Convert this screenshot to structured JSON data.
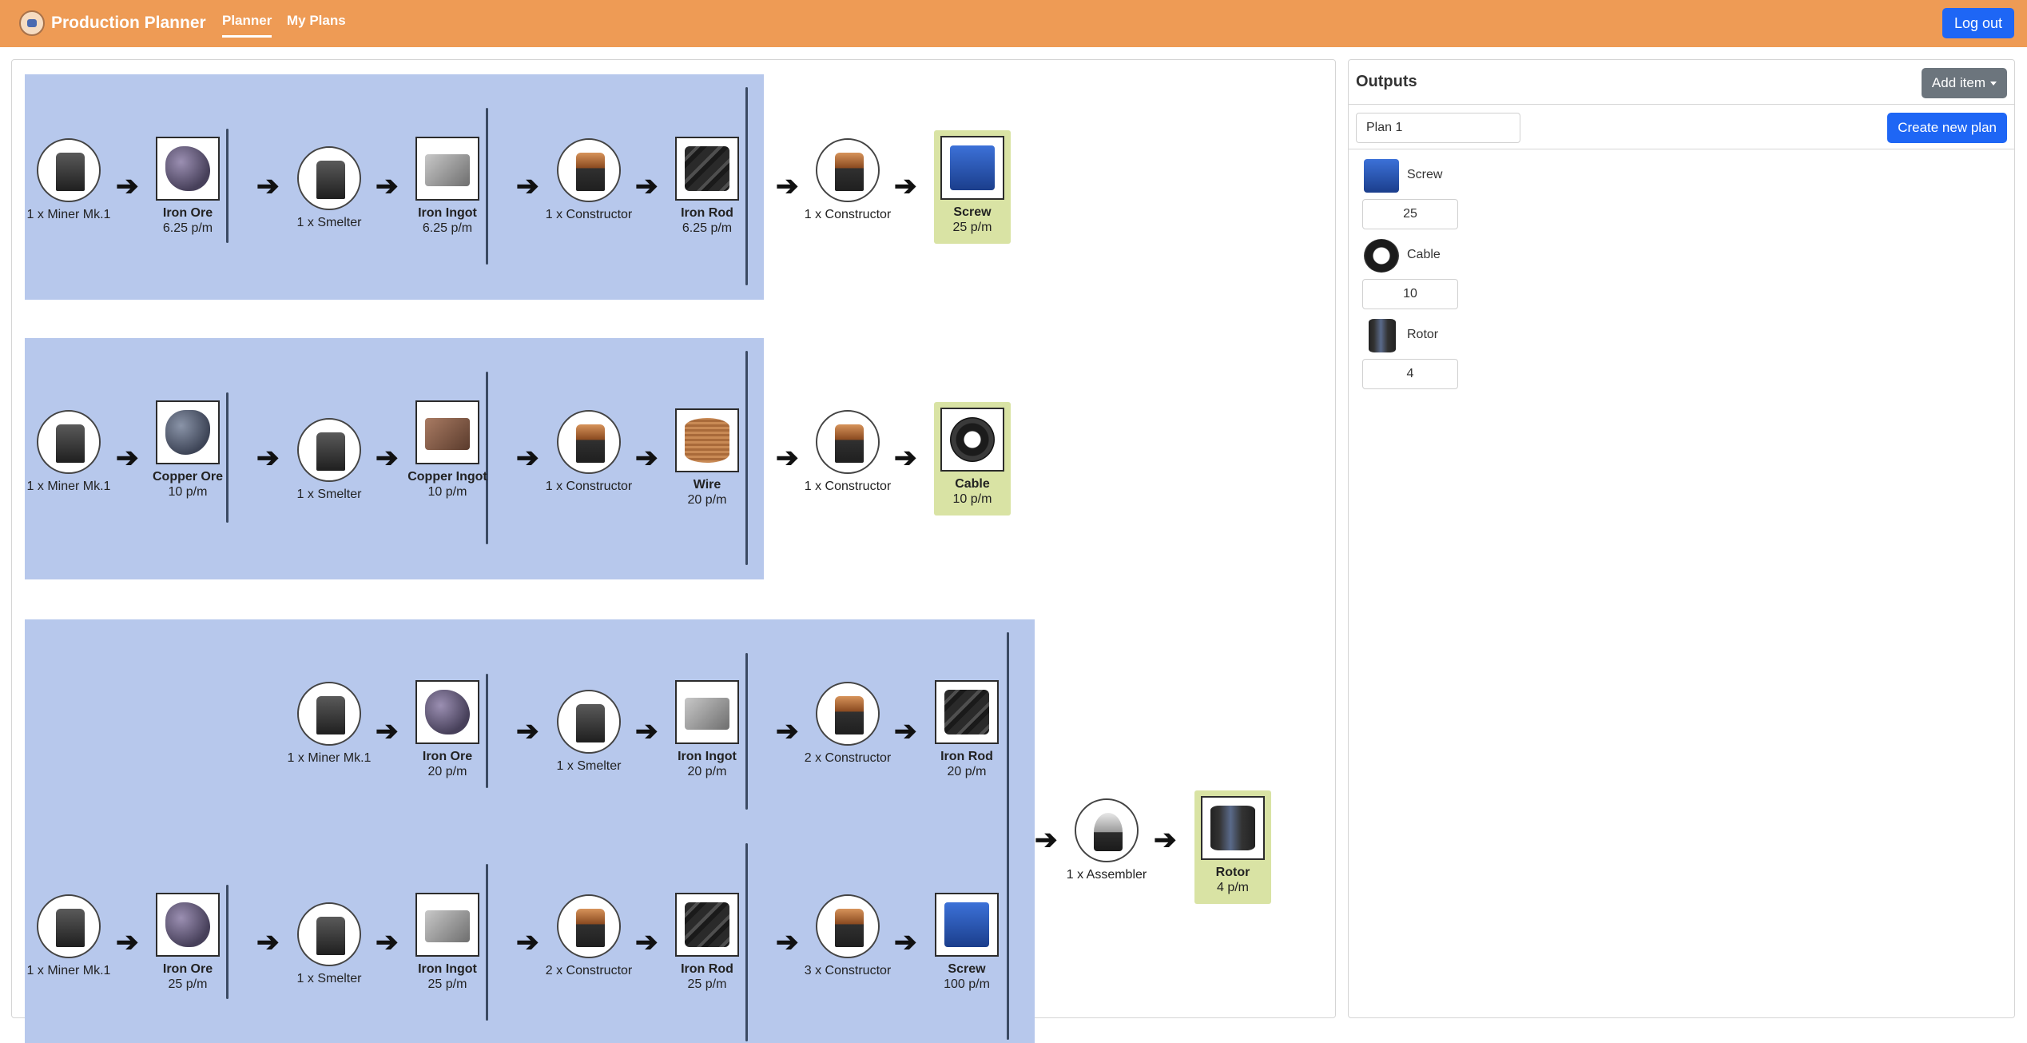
{
  "nav": {
    "brand": "Production Planner",
    "links": [
      "Planner",
      "My Plans"
    ],
    "logout": "Log out"
  },
  "chains": [
    {
      "nodes": [
        {
          "kind": "machine",
          "label": "1 x Miner Mk.1",
          "icon": "miner"
        },
        {
          "kind": "item",
          "name": "Iron Ore",
          "rate": "6.25 p/m",
          "icon": "iron-ore"
        },
        {
          "kind": "machine",
          "label": "1 x Smelter",
          "icon": "smelter"
        },
        {
          "kind": "item",
          "name": "Iron Ingot",
          "rate": "6.25 p/m",
          "icon": "iron-ingot"
        },
        {
          "kind": "machine",
          "label": "1 x Constructor",
          "icon": "constructor"
        },
        {
          "kind": "item",
          "name": "Iron Rod",
          "rate": "6.25 p/m",
          "icon": "iron-rod"
        },
        {
          "kind": "machine",
          "label": "1 x Constructor",
          "icon": "constructor"
        },
        {
          "kind": "final",
          "name": "Screw",
          "rate": "25 p/m",
          "icon": "screw"
        }
      ]
    },
    {
      "nodes": [
        {
          "kind": "machine",
          "label": "1 x Miner Mk.1",
          "icon": "miner"
        },
        {
          "kind": "item",
          "name": "Copper Ore",
          "rate": "10 p/m",
          "icon": "copper-ore"
        },
        {
          "kind": "machine",
          "label": "1 x Smelter",
          "icon": "smelter"
        },
        {
          "kind": "item",
          "name": "Copper Ingot",
          "rate": "10 p/m",
          "icon": "copper-ingot"
        },
        {
          "kind": "machine",
          "label": "1 x Constructor",
          "icon": "constructor"
        },
        {
          "kind": "item",
          "name": "Wire",
          "rate": "20 p/m",
          "icon": "wire"
        },
        {
          "kind": "machine",
          "label": "1 x Constructor",
          "icon": "constructor"
        },
        {
          "kind": "final",
          "name": "Cable",
          "rate": "10 p/m",
          "icon": "cable"
        }
      ]
    },
    {
      "rows": [
        {
          "nodes": [
            {
              "kind": "machine",
              "label": "1 x Miner Mk.1",
              "icon": "miner"
            },
            {
              "kind": "item",
              "name": "Iron Ore",
              "rate": "20 p/m",
              "icon": "iron-ore"
            },
            {
              "kind": "machine",
              "label": "1 x Smelter",
              "icon": "smelter"
            },
            {
              "kind": "item",
              "name": "Iron Ingot",
              "rate": "20 p/m",
              "icon": "iron-ingot"
            },
            {
              "kind": "machine",
              "label": "2 x Constructor",
              "icon": "constructor"
            },
            {
              "kind": "item",
              "name": "Iron Rod",
              "rate": "20 p/m",
              "icon": "iron-rod"
            }
          ]
        },
        {
          "nodes": [
            {
              "kind": "machine",
              "label": "1 x Miner Mk.1",
              "icon": "miner"
            },
            {
              "kind": "item",
              "name": "Iron Ore",
              "rate": "25 p/m",
              "icon": "iron-ore"
            },
            {
              "kind": "machine",
              "label": "1 x Smelter",
              "icon": "smelter"
            },
            {
              "kind": "item",
              "name": "Iron Ingot",
              "rate": "25 p/m",
              "icon": "iron-ingot"
            },
            {
              "kind": "machine",
              "label": "2 x Constructor",
              "icon": "constructor"
            },
            {
              "kind": "item",
              "name": "Iron Rod",
              "rate": "25 p/m",
              "icon": "iron-rod"
            },
            {
              "kind": "machine",
              "label": "3 x Constructor",
              "icon": "constructor"
            },
            {
              "kind": "item",
              "name": "Screw",
              "rate": "100 p/m",
              "icon": "screw"
            }
          ]
        }
      ],
      "final_machine": {
        "label": "1 x Assembler",
        "icon": "assembler"
      },
      "final": {
        "name": "Rotor",
        "rate": "4 p/m",
        "icon": "rotor"
      }
    }
  ],
  "outputs": {
    "title": "Outputs",
    "add_item": "Add item",
    "plan_name": "Plan 1",
    "create_plan": "Create new plan",
    "items": [
      {
        "name": "Screw",
        "qty": "25",
        "icon": "screw"
      },
      {
        "name": "Cable",
        "qty": "10",
        "icon": "cable"
      },
      {
        "name": "Rotor",
        "qty": "4",
        "icon": "rotor"
      }
    ]
  },
  "colors": {
    "navbar": "#ee9b55",
    "chain_bg": "#b7c8ec",
    "final_bg": "#d9e3a4",
    "primary": "#1e66f5",
    "secondary": "#6c757d"
  }
}
